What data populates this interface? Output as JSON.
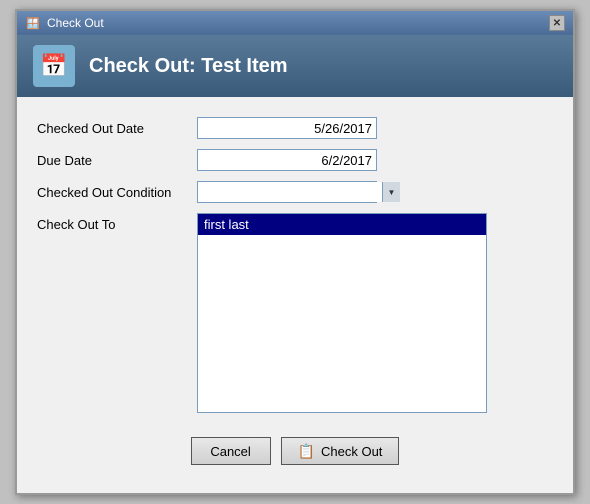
{
  "window": {
    "title": "Check Out",
    "close_label": "✕"
  },
  "header": {
    "title": "Check Out: Test Item",
    "icon": "📅"
  },
  "form": {
    "checked_out_date_label": "Checked Out Date",
    "checked_out_date_value": "5/26/2017",
    "due_date_label": "Due Date",
    "due_date_value": "6/2/2017",
    "checked_out_condition_label": "Checked Out Condition",
    "checked_out_condition_value": "",
    "check_out_to_label": "Check Out To",
    "check_out_to_selected": "first last"
  },
  "buttons": {
    "cancel_label": "Cancel",
    "checkout_label": "Check Out",
    "checkout_icon": "📋"
  }
}
